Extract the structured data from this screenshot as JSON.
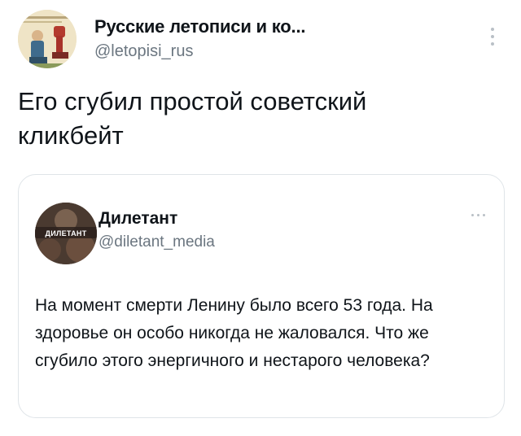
{
  "tweet": {
    "author": {
      "name": "Русские летописи и ко...",
      "handle": "@letopisi_rus"
    },
    "text": "Его сгубил простой советский кликбейт",
    "quoted": {
      "author": {
        "name": "Дилетант",
        "handle": "@diletant_media",
        "avatar_label": "ДИЛЕТАНТ"
      },
      "text": "На момент смерти Ленину было всего 53 года. На здоровье он особо никогда не жаловался. Что же сгубило этого энергичного и нестарого человека?"
    }
  },
  "colors": {
    "text_primary": "#0f1419",
    "text_secondary": "#6b7680",
    "card_border": "#dfe4e8",
    "icon_muted": "#b9c0c6"
  }
}
